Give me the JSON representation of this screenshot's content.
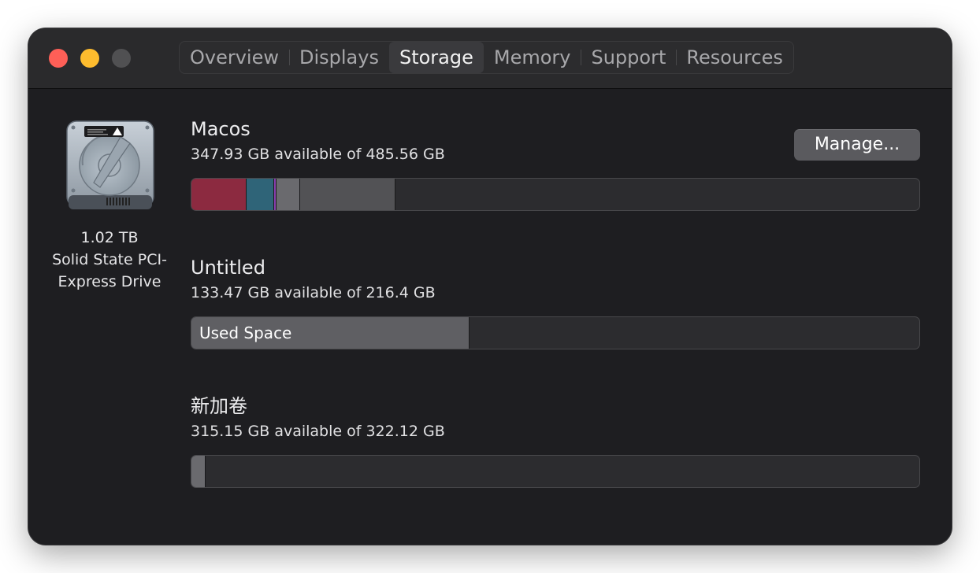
{
  "window": {
    "tabs": [
      {
        "label": "Overview",
        "active": false
      },
      {
        "label": "Displays",
        "active": false
      },
      {
        "label": "Storage",
        "active": true
      },
      {
        "label": "Memory",
        "active": false
      },
      {
        "label": "Support",
        "active": false
      },
      {
        "label": "Resources",
        "active": false
      }
    ]
  },
  "drive": {
    "capacity": "1.02 TB",
    "type_line1": "Solid State PCI-",
    "type_line2": "Express Drive",
    "icon": "hard-drive-icon"
  },
  "manage_button": "Manage...",
  "volumes": [
    {
      "name": "Macos",
      "available": "347.93 GB available of 485.56 GB",
      "segments": [
        {
          "color": "#8c2a40",
          "fraction": 0.076
        },
        {
          "color": "#2f6478",
          "fraction": 0.038
        },
        {
          "color": "#8a3fb0",
          "fraction": 0.003
        },
        {
          "color": "#6a6a6e",
          "fraction": 0.033
        },
        {
          "color": "#525255",
          "fraction": 0.131
        }
      ]
    },
    {
      "name": "Untitled",
      "available": "133.47 GB available of 216.4 GB",
      "segments": [
        {
          "color": "#5f5f63",
          "fraction": 0.382,
          "label": "Used Space"
        }
      ]
    },
    {
      "name": "新加卷",
      "available": "315.15 GB available of 322.12 GB",
      "segments": [
        {
          "color": "#6a6a6e",
          "fraction": 0.02
        }
      ]
    }
  ]
}
